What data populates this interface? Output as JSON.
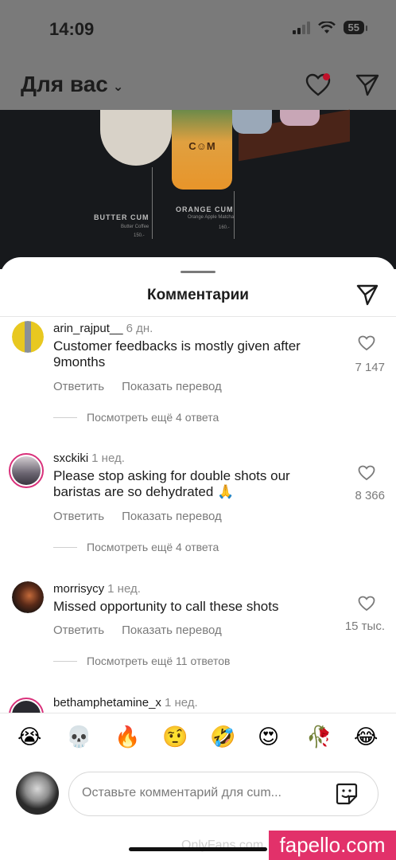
{
  "status": {
    "time": "14:09",
    "battery": "55"
  },
  "feed": {
    "title": "Для вас"
  },
  "photo": {
    "cup1_label": "BUTTER CUM",
    "cup1_sub": "Butter Coffee",
    "cup1_price": "150.-",
    "cup2_label": "ORANGE CUM",
    "cup2_sub": "Orange Apple Matcha",
    "cup2_price": "160.-",
    "cup_logo": "C☺M"
  },
  "sheet": {
    "title": "Комментарии"
  },
  "comments": [
    {
      "user": "arin_rajput__",
      "time": "6 дн.",
      "text": "Customer feedbacks is mostly given after 9months",
      "likes": "7 147",
      "reply": "Ответить",
      "translate": "Показать перевод",
      "more": "Посмотреть ещё 4 ответа"
    },
    {
      "user": "sxckiki",
      "time": "1 нед.",
      "text": "Please stop asking for double shots our baristas are so dehydrated 🙏",
      "likes": "8 366",
      "reply": "Ответить",
      "translate": "Показать перевод",
      "more": "Посмотреть ещё 4 ответа"
    },
    {
      "user": "morrisycy",
      "time": "1 нед.",
      "text": "Missed opportunity to call these shots",
      "likes": "15 тыс.",
      "reply": "Ответить",
      "translate": "Показать перевод",
      "more": "Посмотреть ещё 11 ответов"
    },
    {
      "user": "bethamphetamine_x",
      "time": "1 нед."
    }
  ],
  "emojis": [
    "😭",
    "💀",
    "🔥",
    "🤨",
    "🤣",
    "😍",
    "🥀",
    "😂"
  ],
  "composer": {
    "placeholder": "Оставьте комментарий для cum..."
  },
  "watermarks": {
    "site": "fapello.com",
    "of": "OnlyFans.com"
  },
  "colors": {
    "accent": "#d9307a",
    "notification": "#c0102a",
    "watermark_bg": "#e2316a"
  }
}
